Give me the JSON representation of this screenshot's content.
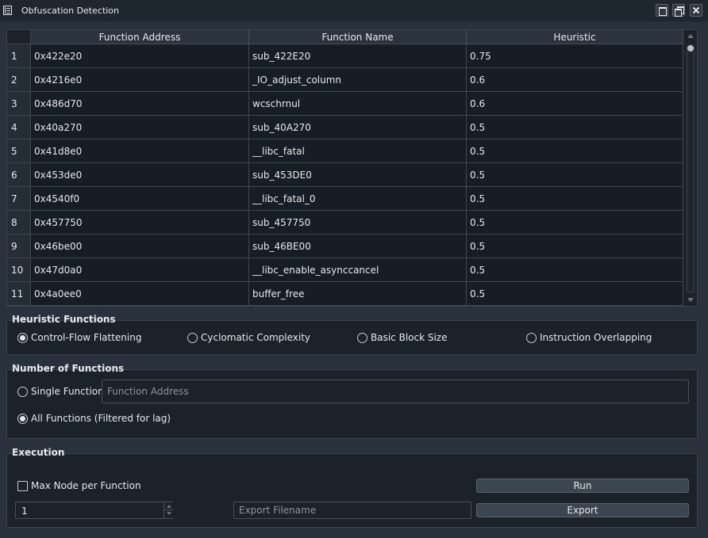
{
  "window": {
    "title": "Obfuscation Detection"
  },
  "table": {
    "columns": [
      "Function Address",
      "Function Name",
      "Heuristic"
    ],
    "rows": [
      {
        "index": "1",
        "address": "0x422e20",
        "name": "sub_422E20",
        "heuristic": "0.75"
      },
      {
        "index": "2",
        "address": "0x4216e0",
        "name": "_IO_adjust_column",
        "heuristic": "0.6"
      },
      {
        "index": "3",
        "address": "0x486d70",
        "name": "wcschrnul",
        "heuristic": "0.6"
      },
      {
        "index": "4",
        "address": "0x40a270",
        "name": "sub_40A270",
        "heuristic": "0.5"
      },
      {
        "index": "5",
        "address": "0x41d8e0",
        "name": "__libc_fatal",
        "heuristic": "0.5"
      },
      {
        "index": "6",
        "address": "0x453de0",
        "name": "sub_453DE0",
        "heuristic": "0.5"
      },
      {
        "index": "7",
        "address": "0x4540f0",
        "name": "__libc_fatal_0",
        "heuristic": "0.5"
      },
      {
        "index": "8",
        "address": "0x457750",
        "name": "sub_457750",
        "heuristic": "0.5"
      },
      {
        "index": "9",
        "address": "0x46be00",
        "name": "sub_46BE00",
        "heuristic": "0.5"
      },
      {
        "index": "10",
        "address": "0x47d0a0",
        "name": "__libc_enable_asynccancel",
        "heuristic": "0.5"
      },
      {
        "index": "11",
        "address": "0x4a0ee0",
        "name": "buffer_free",
        "heuristic": "0.5"
      }
    ]
  },
  "heuristic_functions": {
    "title": "Heuristic Functions",
    "options": [
      "Control-Flow Flattening",
      "Cyclomatic Complexity",
      "Basic Block Size",
      "Instruction Overlapping"
    ],
    "selected": "Control-Flow Flattening"
  },
  "number_of_functions": {
    "title": "Number of Functions",
    "single_label": "Single Function",
    "address_placeholder": "Function Address",
    "all_label": "All Functions (Filtered for lag)",
    "selected": "All Functions (Filtered for lag)"
  },
  "execution": {
    "title": "Execution",
    "max_node_label": "Max Node per Function",
    "max_node_checked": false,
    "max_node_value": "1",
    "export_placeholder": "Export Filename",
    "run_label": "Run",
    "export_label": "Export"
  },
  "colors": {
    "window_bg": "#29323c",
    "panel_bg": "#1b222a",
    "titlebar_bg": "#1e262f",
    "button_bg": "#3c4651",
    "text": "#e6e9ec"
  },
  "icons": {
    "app": "app-window-icon",
    "minimize": "minimize-icon",
    "restore": "restore-icon",
    "close": "close-icon"
  }
}
